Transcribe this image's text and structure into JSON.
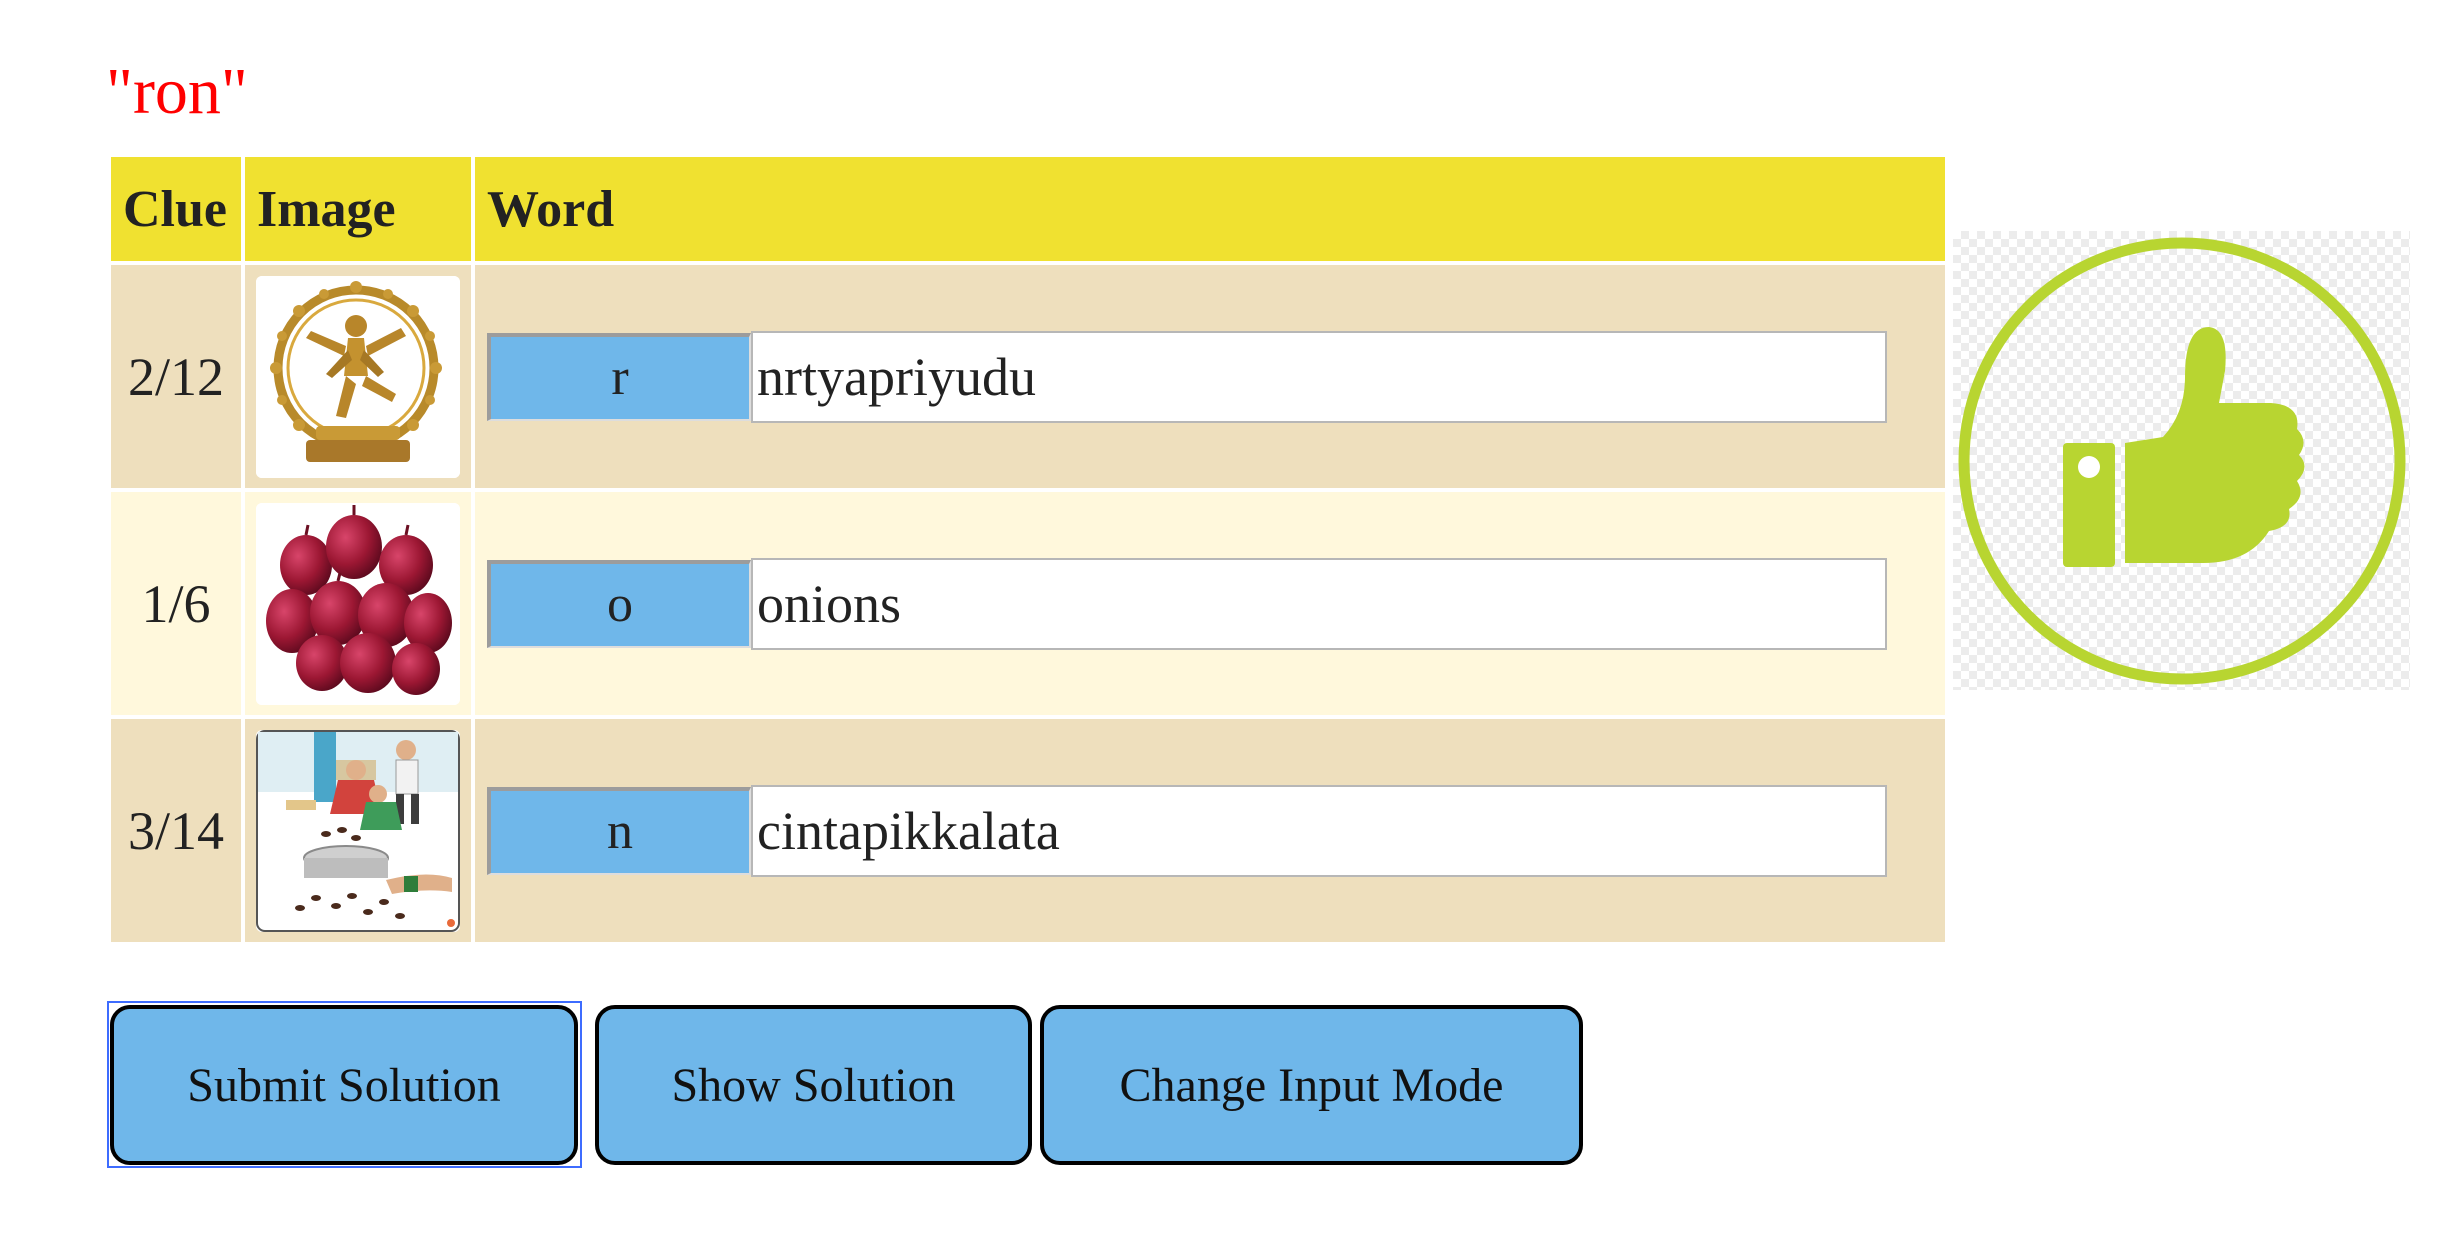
{
  "puzzle": {
    "title": "\"ron\""
  },
  "table": {
    "headers": {
      "clue": "Clue",
      "image": "Image",
      "word": "Word"
    },
    "rows": [
      {
        "clue": "2/12",
        "image": "nataraja-statue",
        "letter": "r",
        "answer": "nrtyapriyudu"
      },
      {
        "clue": "1/6",
        "image": "red-onions",
        "letter": "o",
        "answer": "onions"
      },
      {
        "clue": "3/14",
        "image": "children-gathering-tamarind-seeds",
        "letter": "n",
        "answer": "cintapikkalata"
      }
    ]
  },
  "buttons": {
    "submit": "Submit Solution",
    "show": "Show Solution",
    "change_mode": "Change Input Mode"
  },
  "feedback": {
    "icon": "thumbs-up-icon",
    "color": "#b8d531"
  },
  "colors": {
    "title": "#ff0000",
    "header_bg": "#f0e130",
    "row_odd": "#eedfbd",
    "row_even": "#fff8dc",
    "button_bg": "#6fb7ea"
  }
}
